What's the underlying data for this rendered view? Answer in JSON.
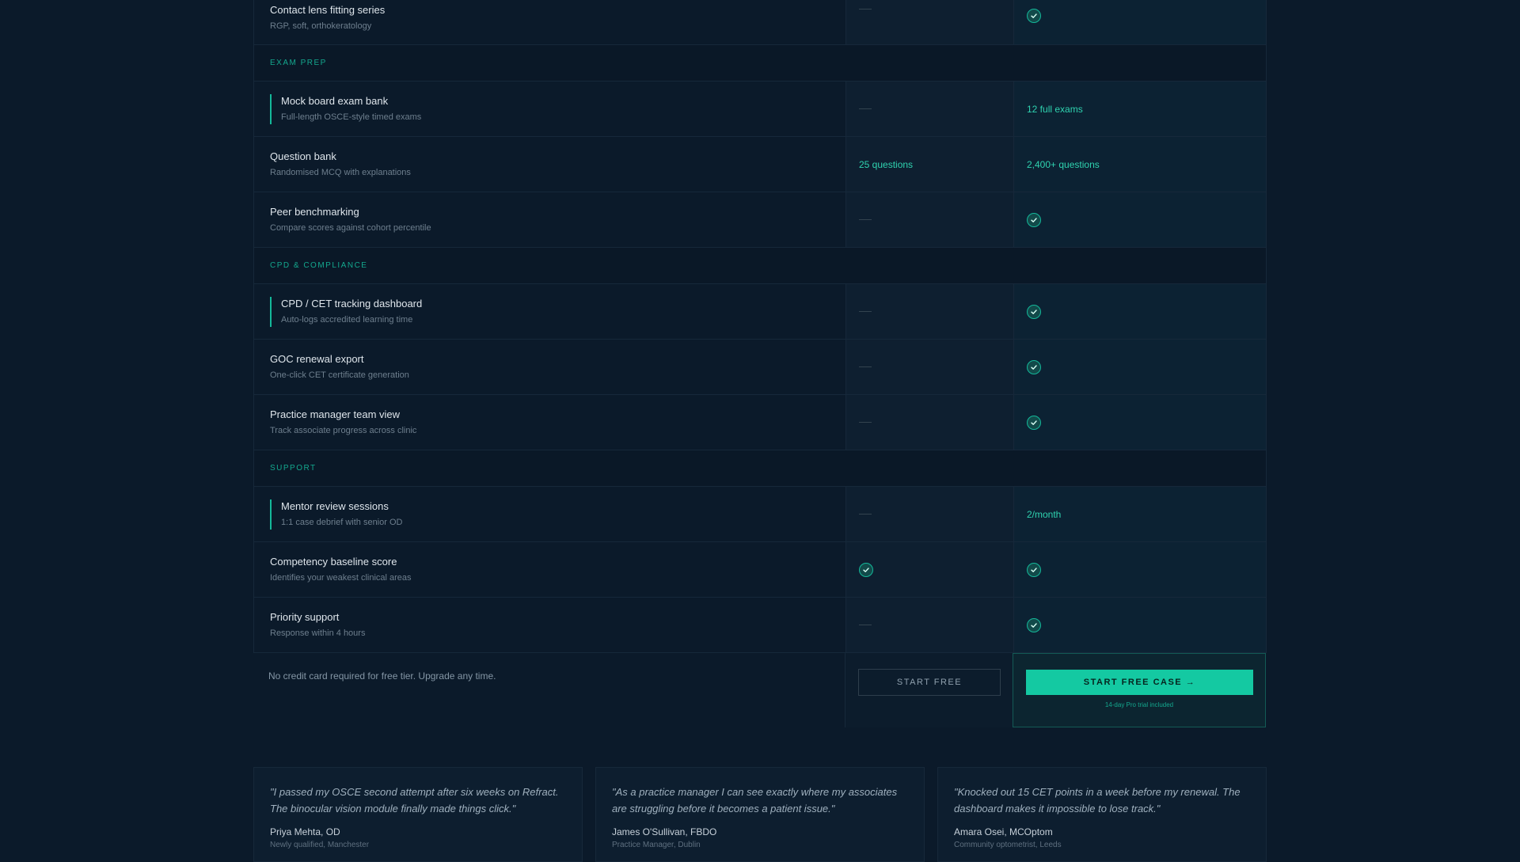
{
  "rows_top": [
    {
      "title": "Contact lens fitting series",
      "sub": "RGP, soft, orthokeratology",
      "free": "dash",
      "pro": "check"
    }
  ],
  "sections": [
    {
      "label": "EXAM PREP",
      "rows": [
        {
          "title": "Mock board exam bank",
          "sub": "Full-length OSCE-style timed exams",
          "free": "dash",
          "pro": "12 full exams",
          "accent": true
        },
        {
          "title": "Question bank",
          "sub": "Randomised MCQ with explanations",
          "free": "25 questions",
          "pro": "2,400+ questions",
          "accent": false
        },
        {
          "title": "Peer benchmarking",
          "sub": "Compare scores against cohort percentile",
          "free": "dash",
          "pro": "check",
          "accent": false
        }
      ]
    },
    {
      "label": "CPD & COMPLIANCE",
      "rows": [
        {
          "title": "CPD / CET tracking dashboard",
          "sub": "Auto-logs accredited learning time",
          "free": "dash",
          "pro": "check",
          "accent": true
        },
        {
          "title": "GOC renewal export",
          "sub": "One-click CET certificate generation",
          "free": "dash",
          "pro": "check",
          "accent": false
        },
        {
          "title": "Practice manager team view",
          "sub": "Track associate progress across clinic",
          "free": "dash",
          "pro": "check",
          "accent": false
        }
      ]
    },
    {
      "label": "SUPPORT",
      "rows": [
        {
          "title": "Mentor review sessions",
          "sub": "1:1 case debrief with senior OD",
          "free": "dash",
          "pro": "2/month",
          "accent": true
        },
        {
          "title": "Competency baseline score",
          "sub": "Identifies your weakest clinical areas",
          "free": "check",
          "pro": "check",
          "accent": false
        },
        {
          "title": "Priority support",
          "sub": "Response within 4 hours",
          "free": "dash",
          "pro": "check",
          "accent": false
        }
      ]
    }
  ],
  "cta": {
    "note": "No credit card required for free tier. Upgrade any time.",
    "free_button": "START FREE",
    "pro_button": "START FREE CASE →",
    "pro_note": "14-day Pro trial included"
  },
  "testimonials": [
    {
      "quote": "\"I passed my OSCE second attempt after six weeks on Refract. The binocular vision module finally made things click.\"",
      "name": "Priya Mehta, OD",
      "role": "Newly qualified, Manchester"
    },
    {
      "quote": "\"As a practice manager I can see exactly where my associates are struggling before it becomes a patient issue.\"",
      "name": "James O'Sullivan, FBDO",
      "role": "Practice Manager, Dublin"
    },
    {
      "quote": "\"Knocked out 15 CET points in a week before my renewal. The dashboard makes it impossible to lose track.\"",
      "name": "Amara Osei, MCOptom",
      "role": "Community optometrist, Leeds"
    }
  ],
  "colors": {
    "accent": "#14c9a2",
    "background": "#0b1a2a"
  }
}
